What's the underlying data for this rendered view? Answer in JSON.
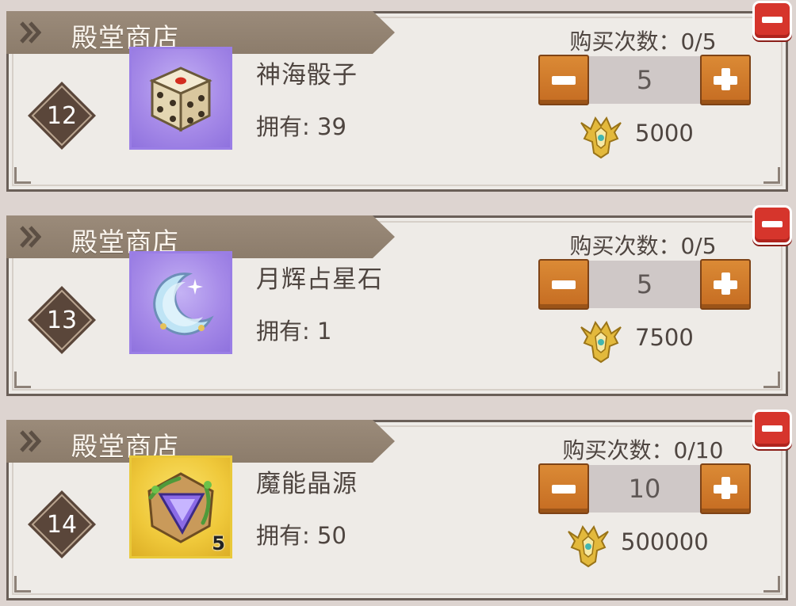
{
  "cards": [
    {
      "shop_title": "殿堂商店",
      "index": "12",
      "item_name": "神海骰子",
      "owned": "拥有: 39",
      "buy_count": "购买次数：0/5",
      "quantity": "5",
      "price": "5000",
      "item_icon": "dice-icon"
    },
    {
      "shop_title": "殿堂商店",
      "index": "13",
      "item_name": "月辉占星石",
      "owned": "拥有: 1",
      "buy_count": "购买次数：0/5",
      "quantity": "5",
      "price": "7500",
      "item_icon": "moon-stone-icon"
    },
    {
      "shop_title": "殿堂商店",
      "index": "14",
      "item_name": "魔能晶源",
      "owned": "拥有: 50",
      "buy_count": "购买次数：0/10",
      "quantity": "10",
      "price": "500000",
      "item_icon": "magic-crystal-icon",
      "stack_count": "5"
    }
  ],
  "currency_icon": "hall-crest-icon",
  "colors": {
    "banner": "#8c7c6b",
    "close": "#d6352c",
    "stepper": "#c56c22",
    "rare_frame": "#a68ae8",
    "epic_frame": "#efc83a"
  }
}
